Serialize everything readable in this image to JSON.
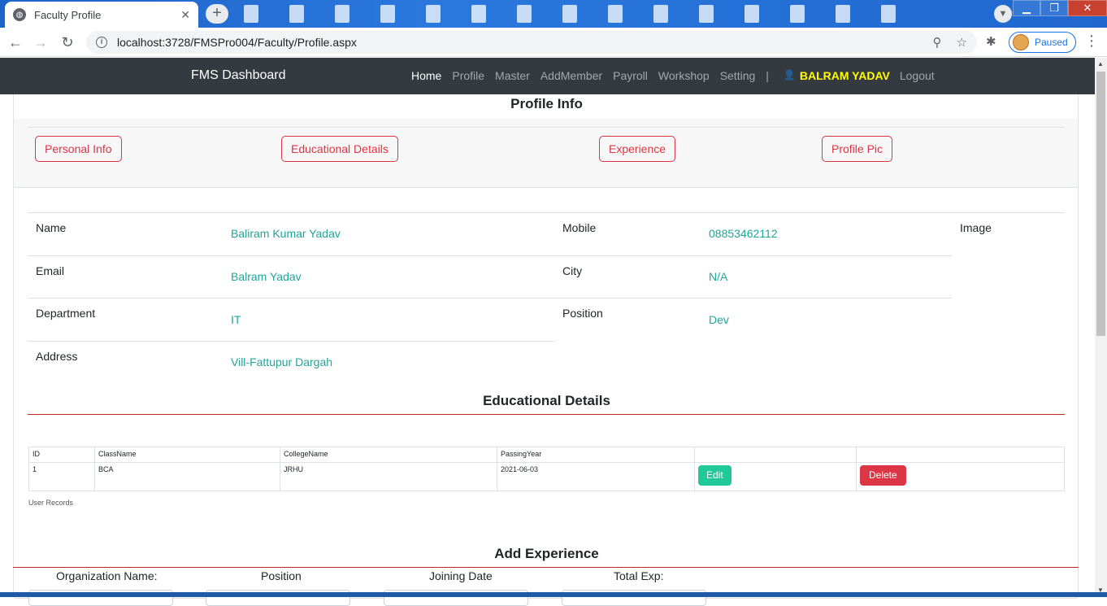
{
  "browser": {
    "tab_title": "Faculty Profile",
    "url": "localhost:3728/FMSPro004/Faculty/Profile.aspx",
    "profile_status": "Paused"
  },
  "navbar": {
    "brand": "FMS Dashboard",
    "links": [
      "Home",
      "Profile",
      "Master",
      "AddMember",
      "Payroll",
      "Workshop",
      "Setting"
    ],
    "separator": "|",
    "username": "BALRAM YADAV",
    "logout": "Logout"
  },
  "profile": {
    "title": "Profile Info",
    "tabs": [
      "Personal Info",
      "Educational Details",
      "Experience",
      "Profile Pic"
    ],
    "fields": {
      "name_label": "Name",
      "name_value": "Baliram Kumar Yadav",
      "mobile_label": "Mobile",
      "mobile_value": "08853462112",
      "image_label": "Image",
      "email_label": "Email",
      "email_value": "Balram Yadav",
      "city_label": "City",
      "city_value": "N/A",
      "department_label": "Department",
      "department_value": "IT",
      "position_label": "Position",
      "position_value": "Dev",
      "address_label": "Address",
      "address_value": "Vill-Fattupur Dargah"
    }
  },
  "education": {
    "title": "Educational Details",
    "columns": [
      "ID",
      "ClassName",
      "CollegeName",
      "PassingYear"
    ],
    "rows": [
      {
        "id": "1",
        "class_name": "BCA",
        "college_name": "JRHU",
        "passing_year": "2021-06-03",
        "edit": "Edit",
        "delete": "Delete"
      }
    ],
    "caption": "User Records"
  },
  "experience": {
    "title": "Add Experience",
    "labels": [
      "Organization Name:",
      "Position",
      "Joining Date",
      "Total Exp:"
    ]
  },
  "colors": {
    "navbar_bg": "#343a40",
    "accent_red": "#dc3545",
    "value_teal": "#20a59a",
    "username_yellow": "#ffff00",
    "edit_green": "#20c997"
  }
}
